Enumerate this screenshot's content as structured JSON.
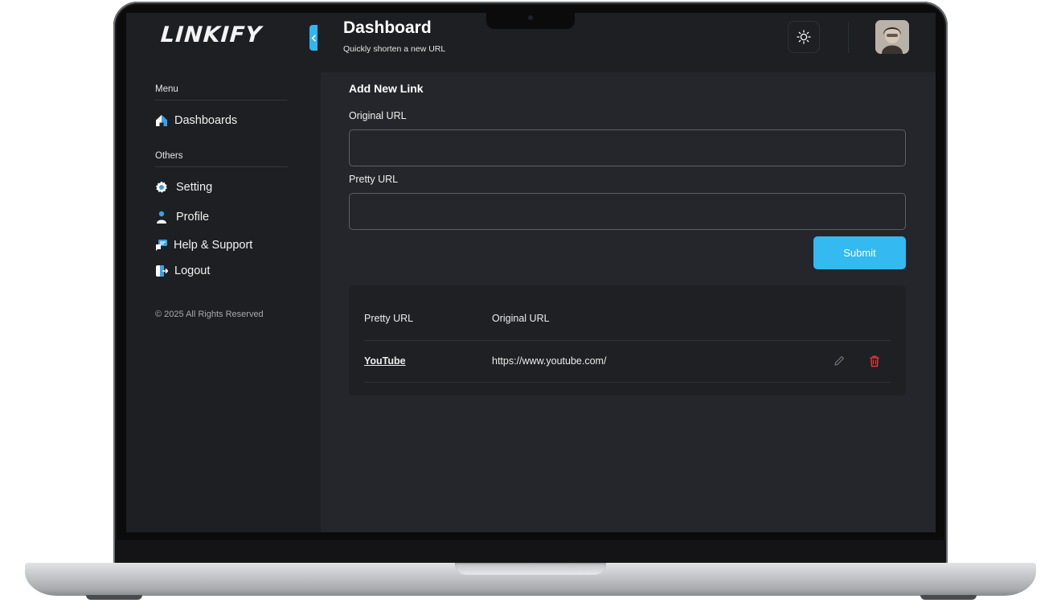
{
  "app": {
    "logo": "LINKIFY",
    "page_title": "Dashboard",
    "page_subtitle": "Quickly shorten a new URL"
  },
  "sidebar": {
    "menu_heading": "Menu",
    "menu_items": [
      {
        "label": "Dashboards",
        "icon": "home-icon"
      }
    ],
    "others_heading": "Others",
    "other_items": [
      {
        "label": "Setting",
        "icon": "gear-icon"
      },
      {
        "label": "Profile",
        "icon": "user-icon"
      },
      {
        "label": "Help & Support",
        "icon": "support-chat-icon"
      },
      {
        "label": "Logout",
        "icon": "logout-icon"
      }
    ],
    "copyright": "© 2025 All Rights Reserved"
  },
  "header": {
    "theme_toggle_icon": "sun-icon",
    "collapse_icon": "chevron-left-icon"
  },
  "form": {
    "title": "Add New Link",
    "original_url_label": "Original URL",
    "original_url_value": "",
    "pretty_url_label": "Pretty URL",
    "pretty_url_value": "",
    "submit_label": "Submit"
  },
  "table": {
    "columns": [
      "Pretty URL",
      "Original URL"
    ],
    "rows": [
      {
        "pretty_url": "YouTube",
        "original_url": "https://www.youtube.com/",
        "actions": [
          "edit-icon",
          "trash-icon"
        ]
      }
    ]
  },
  "colors": {
    "accent": "#34b9f0",
    "danger": "#e53935",
    "background": "#24262b",
    "sidebar": "#1d1f23"
  }
}
